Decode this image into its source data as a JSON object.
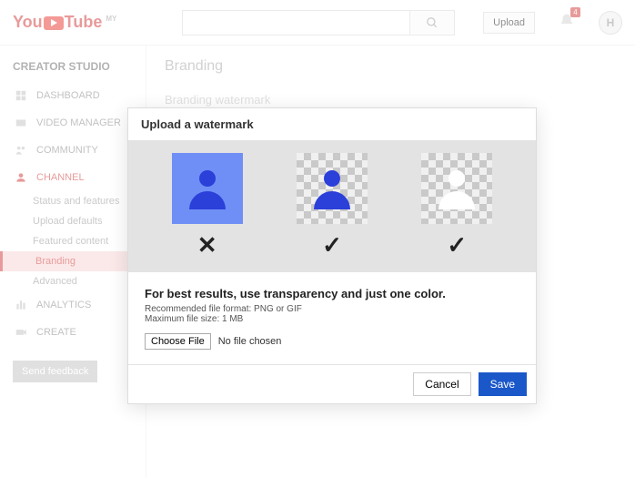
{
  "header": {
    "logo_text_a": "You",
    "logo_text_b": "Tube",
    "region": "MY",
    "search_placeholder": "",
    "upload_label": "Upload",
    "notif_count": "4",
    "avatar_letter": "H"
  },
  "sidebar": {
    "title": "CREATOR STUDIO",
    "items": [
      {
        "label": "DASHBOARD"
      },
      {
        "label": "VIDEO MANAGER"
      },
      {
        "label": "COMMUNITY"
      },
      {
        "label": "CHANNEL"
      },
      {
        "label": "ANALYTICS"
      },
      {
        "label": "CREATE"
      }
    ],
    "channel_sub": [
      {
        "label": "Status and features"
      },
      {
        "label": "Upload defaults"
      },
      {
        "label": "Featured content"
      },
      {
        "label": "Branding"
      },
      {
        "label": "Advanced"
      }
    ],
    "feedback": "Send feedback"
  },
  "content": {
    "title": "Branding",
    "section": "Branding watermark"
  },
  "modal": {
    "title": "Upload a watermark",
    "advice": "For best results, use transparency and just one color.",
    "rec1": "Recommended file format: PNG or GIF",
    "rec2": "Maximum file size: 1 MB",
    "choose": "Choose File",
    "nofile": "No file chosen",
    "cancel": "Cancel",
    "save": "Save",
    "mark_bad": "✕",
    "mark_good1": "✓",
    "mark_good2": "✓"
  }
}
